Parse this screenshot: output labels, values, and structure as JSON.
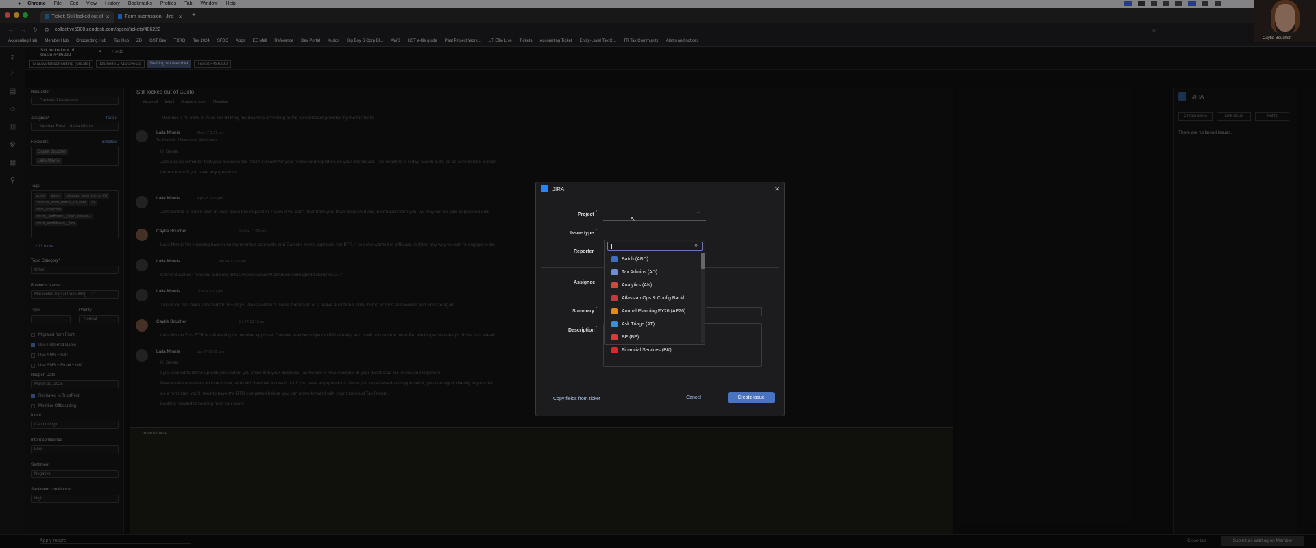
{
  "menubar": {
    "items": [
      "Chrome",
      "File",
      "Edit",
      "View",
      "History",
      "Bookmarks",
      "Profiles",
      "Tab",
      "Window",
      "Help"
    ]
  },
  "tabs": [
    {
      "label": "Ticket: Still locked out of Gusto"
    },
    {
      "label": "Form submission - Jira"
    }
  ],
  "address": {
    "url": "collective5900.zendesk.com/agent/tickets/486222"
  },
  "bookmarks": [
    "Accounting Hub",
    "Member Hub",
    "Onboarding Hub",
    "Tax Hub",
    "ZD",
    "GST Dev",
    "TXRQ",
    "Tax 2024",
    "SFDC",
    "Apps",
    "EE Mell",
    "Reference",
    "Dev Portal",
    "Kudos",
    "Big Boy S Corp Bl...",
    "AWS",
    "GST e-file guide",
    "Past Project Work...",
    "UT Efile Live",
    "Tickets",
    "Accounting Ticket",
    "Entity-Level Tax C...",
    "TR Tax Community",
    "Alerts and notices"
  ],
  "video": {
    "name": "Caytie Boucher"
  },
  "ticket": {
    "tab_title": "Still locked out of Gusto #486222",
    "add": "+ Add",
    "breadcrumbs": [
      "Maravelasconsulting (create)",
      "Danielle J Maravelas",
      "Waiting on Member",
      "Ticket #486222"
    ],
    "subject": "Still locked out of Gusto",
    "meta": [
      "Via email",
      "Intent",
      "Unable to login",
      "Negative"
    ]
  },
  "sidebar": {
    "requester_label": "Requester",
    "requester": "Danielle J Maravelas",
    "assignee_label": "Assignee*",
    "assignee": "Member Relati.../Laila Minnis",
    "take_it": "take it",
    "followers_label": "Followers",
    "follow": "unfollow",
    "followers": [
      "Caytie Boucher",
      "Laila Minnis"
    ],
    "tags_label": "Tags",
    "tags": [
      "active",
      "agent",
      "cleanup_wom_bump_7d",
      "cleanup_wom_bump_7d_sent",
      "cx",
      "hello_collective",
      "intent__software__login_issues...",
      "intent_confidence__low"
    ],
    "more_tags": "+ 11 more",
    "topic_label": "Topic Category*",
    "topic": "Other",
    "business_label": "Business Name",
    "business": "Maravelas Digital Consulting LLC",
    "type_label": "Type",
    "type": "-",
    "priority_label": "Priority",
    "priority": "Normal",
    "checks": [
      "Migrated from Front",
      "Use Preferred Name",
      "Use SMS + IMC",
      "Use SMS + Email + IMC"
    ],
    "reopen_label": "Reopen Date",
    "reopen": "March 10, 2025",
    "checks2": [
      "Reviewed in TrustPilot",
      "Member Offboarding"
    ],
    "intent_label": "Intent",
    "intent": "Can not login",
    "intent_conf_label": "Intent confidence",
    "intent_conf": "Low",
    "sentiment_label": "Sentiment",
    "sentiment": "Negative",
    "sentiment_conf_label": "Sentiment confidence",
    "sentiment_conf": "High"
  },
  "conversation": {
    "top_line": "Member is on track to have her BTR by the deadline according to the spreadsheet provided by the tax team.",
    "messages": [
      {
        "name": "Laila Minnis",
        "time": "Mar 17 5:51 am",
        "lines": [
          "To: Danielle J Maravelas  Show more",
          "Hi Dante,",
          "Just a quick reminder that your business tax return is ready for your review and signature on your dashboard. The deadline is today, March 17th, so be sure to take a look!",
          "Let me know if you have any questions."
        ]
      },
      {
        "name": "Laila Minnis",
        "time": "Apr 25 2:05 pm",
        "lines": [
          "Just wanted to check back in, we'll close this request in 7 days if we don't hear from you. If we requested any information from you, we may not be able to proceed until"
        ]
      },
      {
        "name": "Caytie Boucher",
        "time": "Jun 04 11:29 am",
        "lines": [
          "Laila Minnis I'm checking back in on my member approvals and Danielle never approved her BTR. I see she wanted to offboard. is there any way we can re-engage to clo"
        ]
      },
      {
        "name": "Laila Minnis",
        "time": "Jun 04 12:03 pm",
        "lines": [
          "Caytie Boucher I reached out here: https://collective5900.zendesk.com/agent/tickets/757277"
        ]
      },
      {
        "name": "Laila Minnis",
        "time": "Jun 04 1:01 pm",
        "lines": [
          "This ticket has been snoozed for 30+ days. Please either 1. solve if resolved or 2. leave an internal note, bump actions still needed and Snooze again."
        ]
      },
      {
        "name": "Caytie Boucher",
        "time": "Jul 07 10:13 am",
        "lines": [
          "Laila Minnis This BTR is still waiting on member approval. Danielle may be subject to PAI already, and it will only accrue more PAI the longer she delays. If she has alread"
        ]
      },
      {
        "name": "Laila Minnis",
        "time": "Jul 07 11:02 am",
        "lines": [
          "Hi Dante,",
          "I just wanted to follow up with you and let you know that your Business Tax Return is now available in your dashboard for review and signature.",
          "Please take a moment to look it over, and don't hesitate to reach out if you have any questions. Once you've reviewed and approved it, you can sign it directly in your das",
          "As a reminder, you'll need to have the BTR completed before you can move forward with your Individual Tax Return.",
          "Looking forward to hearing from you soon!"
        ]
      }
    ],
    "internal_note": "Internal note"
  },
  "right": {
    "title": "JIRA",
    "create": "Create issue",
    "link": "Link issue",
    "notify": "Notify",
    "empty": "There are no linked issues."
  },
  "bottom": {
    "macro": "Apply macro",
    "close_tab": "Close tab",
    "submit": "Submit as Waiting on Member"
  },
  "modal": {
    "title": "JIRA",
    "project_label": "Project",
    "issue_label": "Issue type",
    "reporter_label": "Reporter",
    "assignee_label": "Assignee",
    "summary_label": "Summary",
    "description_label": "Description",
    "copy": "Copy fields from ticket",
    "cancel": "Cancel",
    "create": "Create issue",
    "search_placeholder": "",
    "options": [
      {
        "label": "Batch (ABD)",
        "color": "#3a6fc4"
      },
      {
        "label": "Tax Admins (AD)",
        "color": "#6a8fd8"
      },
      {
        "label": "Analytics (AN)",
        "color": "#d04a3a"
      },
      {
        "label": "Atlassian Ops & Config Backl...",
        "color": "#c43a3a"
      },
      {
        "label": "Annual Planning FY26 (AP26)",
        "color": "#e08a1a"
      },
      {
        "label": "Ask Triage (AT)",
        "color": "#3a8fd8"
      },
      {
        "label": "BE (BE)",
        "color": "#d83a3a"
      },
      {
        "label": "Financial Services (BK)",
        "color": "#d82a2a"
      }
    ]
  }
}
